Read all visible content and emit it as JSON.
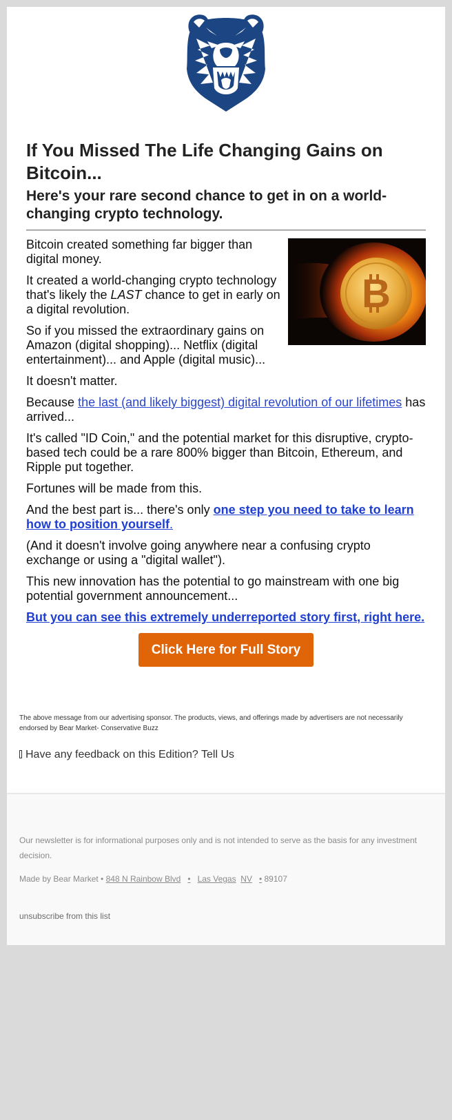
{
  "brand": {
    "logo": "bear-head-logo",
    "logo_color": "#1c4583"
  },
  "article": {
    "headline": "If You Missed The Life Changing Gains on Bitcoin...",
    "subhead": "Here's your rare second chance to get in on a world-changing crypto technology.",
    "hero_image": "flaming-bitcoin-image",
    "paragraphs": {
      "p1": "Bitcoin created something far bigger than digital money.",
      "p2_before": "It created a world-changing crypto technology that's likely the ",
      "p2_em": "LAST",
      "p2_after": " chance to get in early on a digital revolution.",
      "p3": "So if you missed the extraordinary gains on Amazon (digital shopping)... Netflix (digital entertainment)... and Apple (digital music)...",
      "p4": "It doesn't matter.",
      "p5_before": "Because ",
      "p5_link": "the last (and likely biggest) digital revolution of our lifetimes",
      "p5_after": " has arrived...",
      "p6": "It's called \"ID Coin,\" and the potential market for this disruptive, crypto-based tech could be a rare 800% bigger than Bitcoin, Ethereum, and Ripple put together.",
      "p7": "Fortunes will be made from this.",
      "p8_before": "And the best part is... there's only ",
      "p8_link": "one step you need to take to learn how to position yourself",
      "p8_link_tail": ".",
      "p9": "(And it doesn't involve going anywhere near a confusing crypto exchange or using a \"digital wallet\").",
      "p10": "This new innovation has the potential to go mainstream with one big potential government announcement...",
      "p11_link": "But you can see this extremely underreported story first, right here."
    },
    "cta_label": "Click Here for Full Story",
    "cta_color": "#e06408",
    "link_color": "#2a46cc"
  },
  "sponsor_notice": "The above message from our advertising sponsor. The products, views, and offerings made by advertisers are not necessarily endorsed by Bear Market- Conservative Buzz",
  "feedback": {
    "icon": "missing-glyph-icon",
    "text": "Have any feedback on this Edition? Tell Us"
  },
  "footer": {
    "disclaimer": "Our newsletter is for informational purposes only and is not intended to serve as the basis for any investment decision.",
    "made_by": "Made by Bear Market • ",
    "street": "848 N Rainbow Blvd",
    "sep1": "•",
    "city": "Las Vegas",
    "state": "NV",
    "sep2": "•",
    "zip": " 89107",
    "unsubscribe": "unsubscribe from this list"
  }
}
